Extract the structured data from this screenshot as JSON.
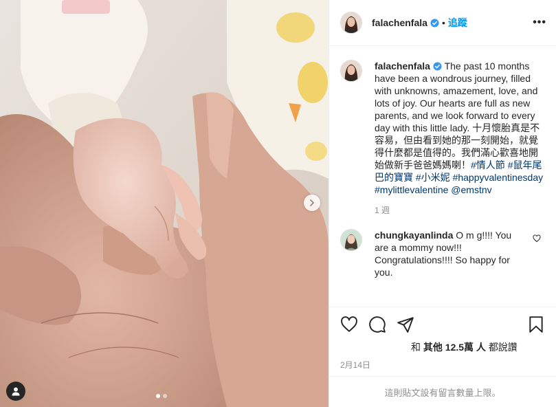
{
  "post": {
    "author": "falachenfala",
    "separator": "•",
    "follow_label": "追蹤",
    "more_label": "•••",
    "caption": {
      "username": "falachenfala",
      "text": "The past 10 months have been a wondrous journey, filled with unknowns, amazement, love, and lots of joy. Our hearts are full as new parents, and we look forward to every day with this little lady. 十月懷胎真是不容易，但由看到她的那一刻開始，就覺得什麼都是值得的。我們滿心歡喜地開始做新手爸爸媽媽喇！",
      "hashtags": [
        "#情人節",
        "#鼠年尾巴的寶寶",
        "#小米妮",
        "#happyvalentinesday",
        "#mylittlevalentine"
      ],
      "mention": "@emstnv",
      "time": "1 週"
    },
    "reply": {
      "username": "chungkayanlinda",
      "text": "O m g!!!! You are a mommy now!!! Congratulations!!!! So happy for you."
    },
    "likes": {
      "prefix": "和",
      "bold": "其他 12.5萬 人",
      "suffix": "都說讚"
    },
    "date": "2月14日",
    "comments_closed": "這則貼文設有留言數量上限。"
  },
  "carousel": {
    "current": 1,
    "total": 2
  },
  "colors": {
    "link_blue": "#0095f6",
    "hashtag": "#00376b",
    "muted": "#8e8e8e",
    "text": "#262626"
  },
  "icons": [
    "verified-badge-icon",
    "chevron-right-icon",
    "user-tag-icon",
    "heart-icon",
    "comment-icon",
    "share-icon",
    "save-icon"
  ]
}
